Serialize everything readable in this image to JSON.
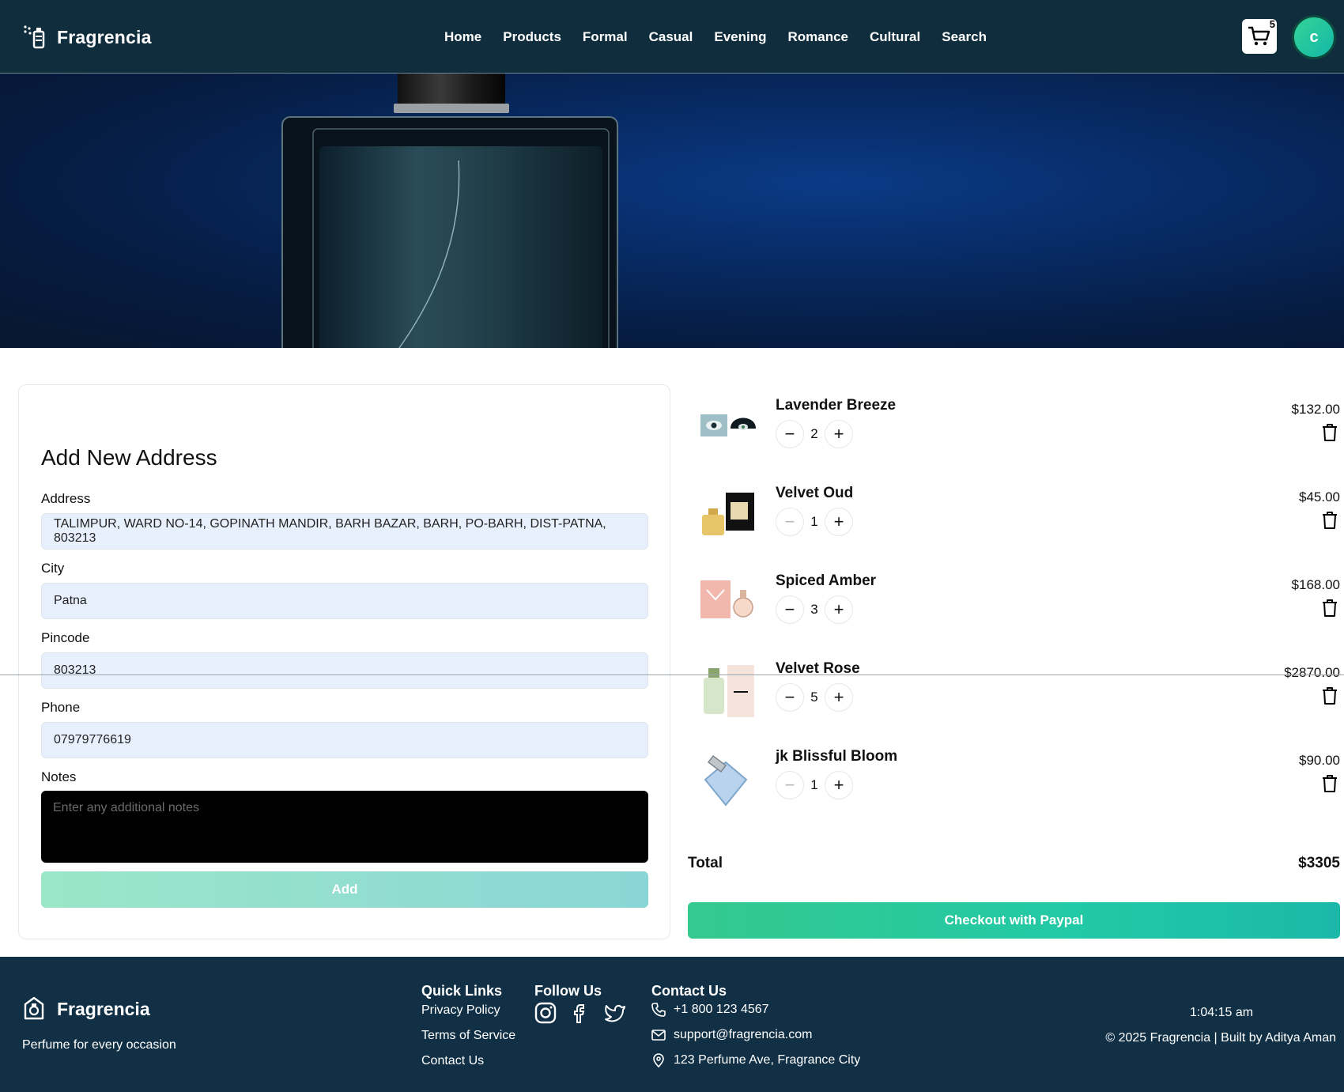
{
  "header": {
    "brand": "Fragrencia",
    "nav": [
      "Home",
      "Products",
      "Formal",
      "Casual",
      "Evening",
      "Romance",
      "Cultural",
      "Search"
    ],
    "cart_count": "5",
    "avatar_initial": "c"
  },
  "form": {
    "title": "Add New Address",
    "address_label": "Address",
    "address_value": "TALIMPUR, WARD NO-14, GOPINATH MANDIR, BARH BAZAR, BARH, PO-BARH, DIST-PATNA, 803213",
    "city_label": "City",
    "city_value": "Patna",
    "pincode_label": "Pincode",
    "pincode_value": "803213",
    "phone_label": "Phone",
    "phone_value": "07979776619",
    "notes_label": "Notes",
    "notes_placeholder": "Enter any additional notes",
    "add_label": "Add"
  },
  "cart": {
    "items": [
      {
        "name": "Lavender Breeze",
        "qty": "2",
        "price": "$132.00"
      },
      {
        "name": "Velvet Oud",
        "qty": "1",
        "price": "$45.00"
      },
      {
        "name": "Spiced Amber",
        "qty": "3",
        "price": "$168.00"
      },
      {
        "name": "Velvet Rose",
        "qty": "5",
        "price": "$2870.00"
      },
      {
        "name": "jk Blissful Bloom",
        "qty": "1",
        "price": "$90.00"
      }
    ],
    "total_label": "Total",
    "total_value": "$3305",
    "checkout_label": "Checkout with Paypal"
  },
  "footer": {
    "brand": "Fragrencia",
    "tagline": "Perfume for every occasion",
    "quick_links_title": "Quick Links",
    "quick_links": [
      "Privacy Policy",
      "Terms of Service",
      "Contact Us"
    ],
    "follow_title": "Follow Us",
    "contact_title": "Contact Us",
    "phone": "+1 800 123 4567",
    "email": "support@fragrencia.com",
    "address": "123 Perfume Ave, Fragrance City",
    "time": "1:04:15 am",
    "copyright": "© 2025 Fragrencia | Built by Aditya Aman"
  },
  "colors": {
    "header_bg": "#0f2d3d",
    "footer_bg": "#113045",
    "accent": "#2dc9a0",
    "input_bg": "#e8f0fe"
  },
  "icons": [
    "perfume-logo-icon",
    "cart-icon",
    "minus-icon",
    "plus-icon",
    "trash-icon",
    "instagram-icon",
    "facebook-icon",
    "twitter-icon",
    "phone-icon",
    "mail-icon",
    "map-pin-icon"
  ]
}
